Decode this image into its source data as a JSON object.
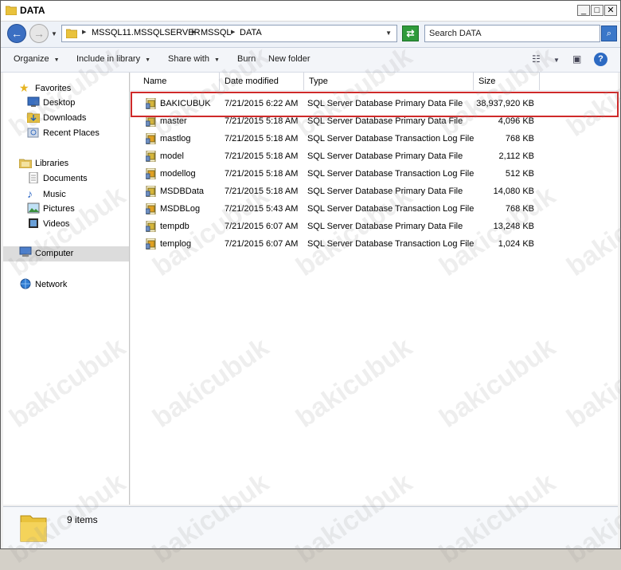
{
  "window": {
    "title": "DATA"
  },
  "address": {
    "crumbs": [
      "MSSQL11.MSSQLSERVER",
      "MSSQL",
      "DATA"
    ],
    "search_placeholder": "Search DATA"
  },
  "toolbar": {
    "organize": "Organize",
    "include_in_library": "Include in library",
    "share_with": "Share with",
    "burn": "Burn",
    "new_folder": "New folder"
  },
  "nav": {
    "favorites": "Favorites",
    "desktop": "Desktop",
    "downloads": "Downloads",
    "recent_places": "Recent Places",
    "libraries": "Libraries",
    "documents": "Documents",
    "music": "Music",
    "pictures": "Pictures",
    "videos": "Videos",
    "computer": "Computer",
    "network": "Network"
  },
  "columns": {
    "name": "Name",
    "date_modified": "Date modified",
    "type": "Type",
    "size": "Size"
  },
  "files": [
    {
      "name": "BAKICUBUK",
      "date": "7/21/2015 6:22 AM",
      "type": "SQL Server Database Primary Data File",
      "size": "38,937,920 KB"
    },
    {
      "name": "master",
      "date": "7/21/2015 5:18 AM",
      "type": "SQL Server Database Primary Data File",
      "size": "4,096 KB"
    },
    {
      "name": "mastlog",
      "date": "7/21/2015 5:18 AM",
      "type": "SQL Server Database Transaction Log File",
      "size": "768 KB"
    },
    {
      "name": "model",
      "date": "7/21/2015 5:18 AM",
      "type": "SQL Server Database Primary Data File",
      "size": "2,112 KB"
    },
    {
      "name": "modellog",
      "date": "7/21/2015 5:18 AM",
      "type": "SQL Server Database Transaction Log File",
      "size": "512 KB"
    },
    {
      "name": "MSDBData",
      "date": "7/21/2015 5:18 AM",
      "type": "SQL Server Database Primary Data File",
      "size": "14,080 KB"
    },
    {
      "name": "MSDBLog",
      "date": "7/21/2015 5:43 AM",
      "type": "SQL Server Database Transaction Log File",
      "size": "768 KB"
    },
    {
      "name": "tempdb",
      "date": "7/21/2015 6:07 AM",
      "type": "SQL Server Database Primary Data File",
      "size": "13,248 KB"
    },
    {
      "name": "templog",
      "date": "7/21/2015 6:07 AM",
      "type": "SQL Server Database Transaction Log File",
      "size": "1,024 KB"
    }
  ],
  "status": {
    "item_count": "9 items"
  },
  "watermark": "bakicubuk",
  "colors": {
    "highlight": "#cf2a2a",
    "back_button": "#3b6fc2",
    "refresh_button": "#2f9b3b"
  }
}
